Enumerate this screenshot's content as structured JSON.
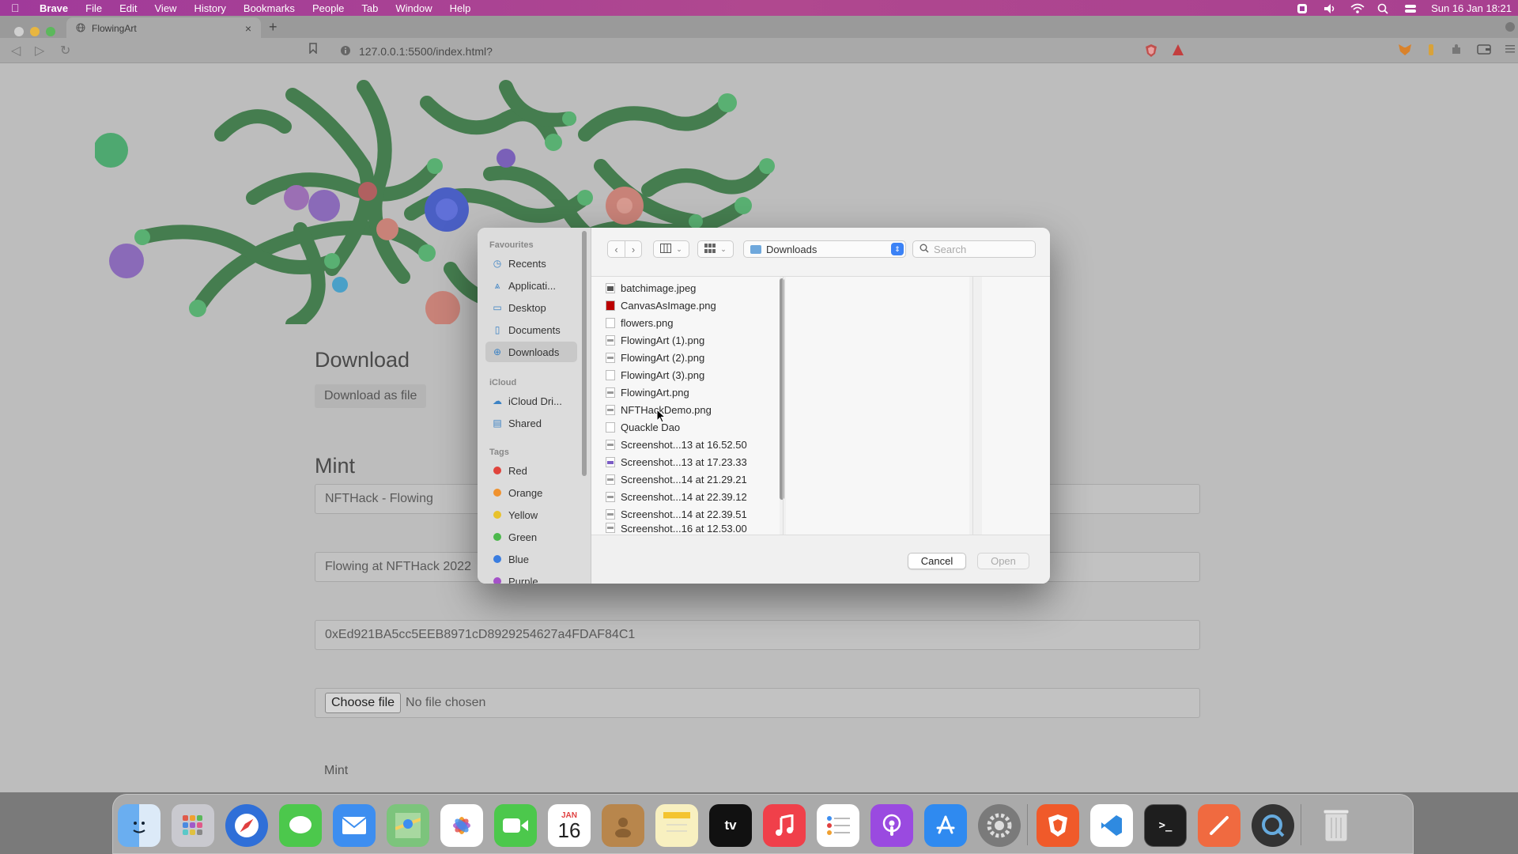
{
  "menubar": {
    "app": "Brave",
    "items": [
      "File",
      "Edit",
      "View",
      "History",
      "Bookmarks",
      "People",
      "Tab",
      "Window",
      "Help"
    ],
    "clock": "Sun 16 Jan  18:21"
  },
  "browser": {
    "tab_title": "FlowingArt",
    "url": "127.0.0.1:5500/index.html?"
  },
  "page": {
    "download_heading": "Download",
    "download_link": "Download as file",
    "mint_heading": "Mint",
    "name_value": "NFTHack - Flowing",
    "description_value": "Flowing at NFTHack 2022",
    "address_value": "0xEd921BA5cc5EEB8971cD8929254627a4FDAF84C1",
    "choose_file_label": "Choose file",
    "no_file_text": "No file chosen",
    "mint_button": "Mint"
  },
  "dialog": {
    "sidebar": {
      "favourites_header": "Favourites",
      "favourites": [
        "Recents",
        "Applicati...",
        "Desktop",
        "Documents",
        "Downloads"
      ],
      "icloud_header": "iCloud",
      "icloud": [
        "iCloud Dri...",
        "Shared"
      ],
      "tags_header": "Tags",
      "tags": [
        {
          "label": "Red",
          "color": "#e0443c"
        },
        {
          "label": "Orange",
          "color": "#f0922e"
        },
        {
          "label": "Yellow",
          "color": "#e8c22c"
        },
        {
          "label": "Green",
          "color": "#4cb84c"
        },
        {
          "label": "Blue",
          "color": "#3a7de0"
        },
        {
          "label": "Purple",
          "color": "#a452c8"
        }
      ]
    },
    "location": "Downloads",
    "search_placeholder": "Search",
    "files": [
      "batchimage.jpeg",
      "CanvasAsImage.png",
      "flowers.png",
      "FlowingArt (1).png",
      "FlowingArt (2).png",
      "FlowingArt (3).png",
      "FlowingArt.png",
      "NFTHackDemo.png",
      "Quackle Dao",
      "Screenshot...13 at 16.52.50",
      "Screenshot...13 at 17.23.33",
      "Screenshot...14 at 21.29.21",
      "Screenshot...14 at 22.39.12",
      "Screenshot...14 at 22.39.51",
      "Screenshot...16 at 12.53.00"
    ],
    "cancel_label": "Cancel",
    "open_label": "Open"
  },
  "dock": {
    "calendar_month": "JAN",
    "calendar_day": "16"
  },
  "colors": {
    "menubar": "#a03a9a",
    "accent": "#3b82f6"
  }
}
